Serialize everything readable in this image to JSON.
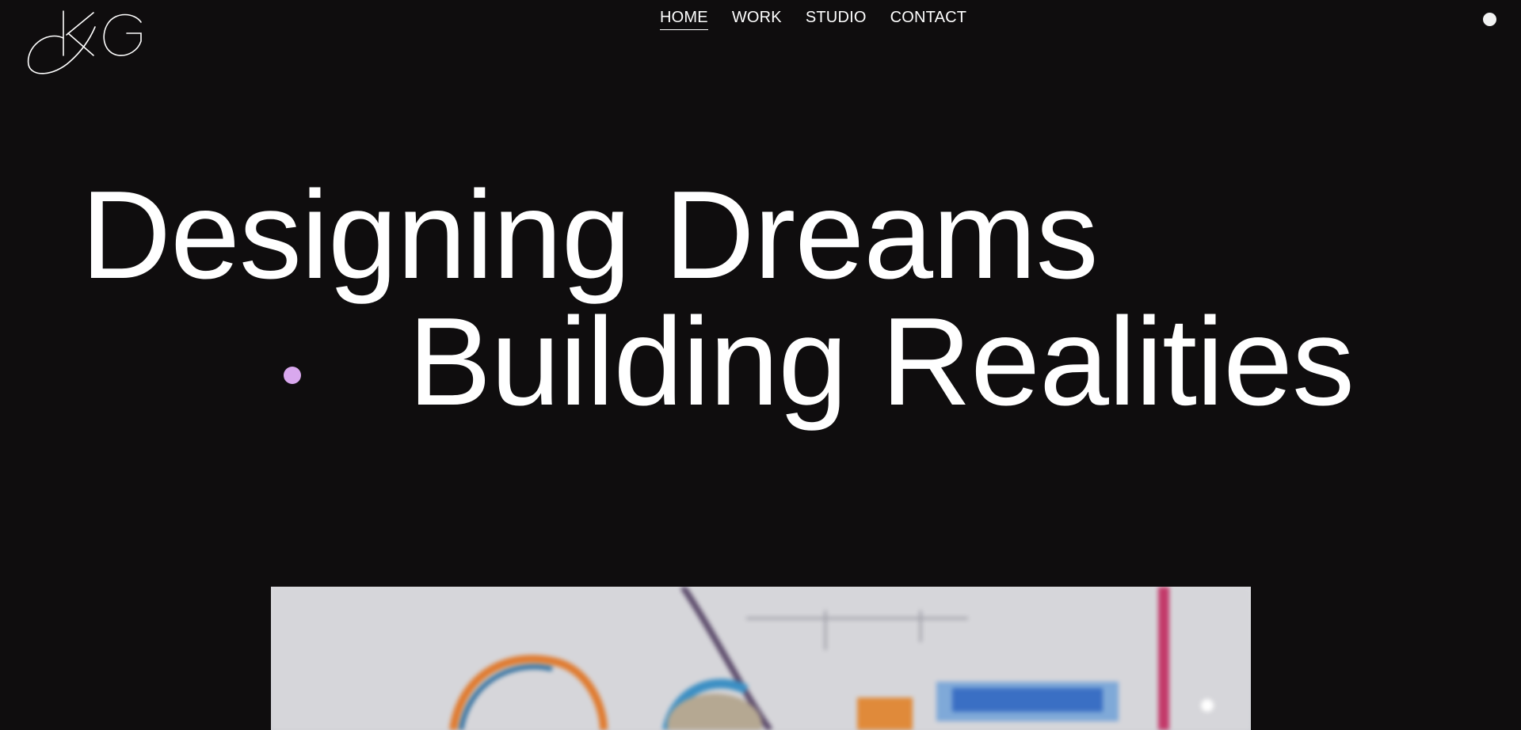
{
  "header": {
    "logo_text": "KG",
    "nav": [
      {
        "label": "HOME",
        "active": true
      },
      {
        "label": "WORK",
        "active": false
      },
      {
        "label": "STUDIO",
        "active": false
      },
      {
        "label": "CONTACT",
        "active": false
      }
    ],
    "menu_icon": "menu-dot-icon"
  },
  "hero": {
    "line1": "Designing Dreams",
    "line2": "Building Realities",
    "accent_color": "#d9a8ee"
  },
  "colors": {
    "background": "#0f0d0e",
    "text": "#ffffff"
  }
}
